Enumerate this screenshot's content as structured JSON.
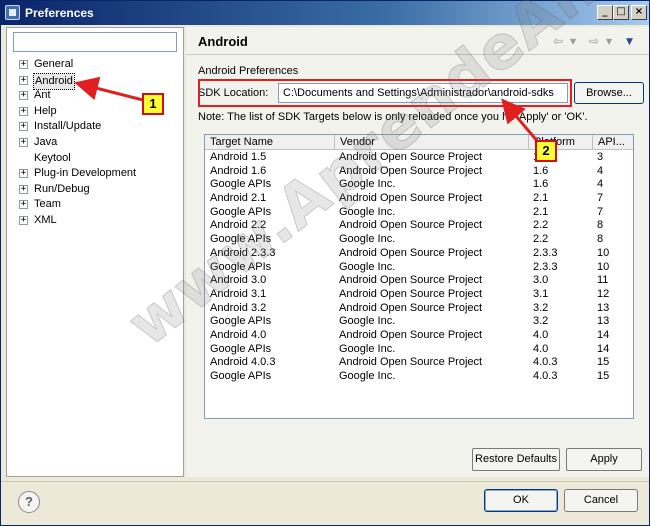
{
  "window": {
    "title": "Preferences"
  },
  "left": {
    "filter_value": "",
    "tree": [
      {
        "label": "General",
        "expandable": true,
        "selected": false
      },
      {
        "label": "Android",
        "expandable": true,
        "selected": true
      },
      {
        "label": "Ant",
        "expandable": true,
        "selected": false
      },
      {
        "label": "Help",
        "expandable": true,
        "selected": false
      },
      {
        "label": "Install/Update",
        "expandable": true,
        "selected": false
      },
      {
        "label": "Java",
        "expandable": true,
        "selected": false
      },
      {
        "label": "Keytool",
        "expandable": false,
        "selected": false
      },
      {
        "label": "Plug-in Development",
        "expandable": true,
        "selected": false
      },
      {
        "label": "Run/Debug",
        "expandable": true,
        "selected": false
      },
      {
        "label": "Team",
        "expandable": true,
        "selected": false
      },
      {
        "label": "XML",
        "expandable": true,
        "selected": false
      }
    ]
  },
  "right": {
    "page_title": "Android",
    "section_label": "Android Preferences",
    "sdk_label": "SDK Location:",
    "sdk_path": "C:\\Documents and Settings\\Administrador\\android-sdks",
    "browse_label": "Browse...",
    "note": "Note: The list of SDK Targets below is only reloaded once you hit 'Apply' or 'OK'.",
    "table": {
      "columns": [
        "Target Name",
        "Vendor",
        "Platform",
        "API..."
      ],
      "rows": [
        [
          "Android 1.5",
          "Android Open Source Project",
          "1.5",
          "3"
        ],
        [
          "Android 1.6",
          "Android Open Source Project",
          "1.6",
          "4"
        ],
        [
          "Google APIs",
          "Google Inc.",
          "1.6",
          "4"
        ],
        [
          "Android 2.1",
          "Android Open Source Project",
          "2.1",
          "7"
        ],
        [
          "Google APIs",
          "Google Inc.",
          "2.1",
          "7"
        ],
        [
          "Android 2.2",
          "Android Open Source Project",
          "2.2",
          "8"
        ],
        [
          "Google APIs",
          "Google Inc.",
          "2.2",
          "8"
        ],
        [
          "Android 2.3.3",
          "Android Open Source Project",
          "2.3.3",
          "10"
        ],
        [
          "Google APIs",
          "Google Inc.",
          "2.3.3",
          "10"
        ],
        [
          "Android 3.0",
          "Android Open Source Project",
          "3.0",
          "11"
        ],
        [
          "Android 3.1",
          "Android Open Source Project",
          "3.1",
          "12"
        ],
        [
          "Android 3.2",
          "Android Open Source Project",
          "3.2",
          "13"
        ],
        [
          "Google APIs",
          "Google Inc.",
          "3.2",
          "13"
        ],
        [
          "Android 4.0",
          "Android Open Source Project",
          "4.0",
          "14"
        ],
        [
          "Google APIs",
          "Google Inc.",
          "4.0",
          "14"
        ],
        [
          "Android 4.0.3",
          "Android Open Source Project",
          "4.0.3",
          "15"
        ],
        [
          "Google APIs",
          "Google Inc.",
          "4.0.3",
          "15"
        ]
      ]
    },
    "restore_defaults_label": "Restore Defaults",
    "apply_label": "Apply"
  },
  "footer": {
    "help_glyph": "?",
    "ok_label": "OK",
    "cancel_label": "Cancel"
  },
  "annotations": {
    "badge_1": "1",
    "badge_2": "2",
    "color": "#e02020",
    "badge_fill": "#ffff33"
  },
  "watermark": "www.AprendeAndroid.com",
  "icons": {
    "app": "preferences-window-icon",
    "minimize": "minimize-icon",
    "maximize": "maximize-icon",
    "close": "close-icon",
    "back": "back-arrow-icon",
    "forward": "forward-arrow-icon",
    "view_menu": "view-menu-icon",
    "help": "help-icon",
    "expander": "plus-expander-icon"
  }
}
